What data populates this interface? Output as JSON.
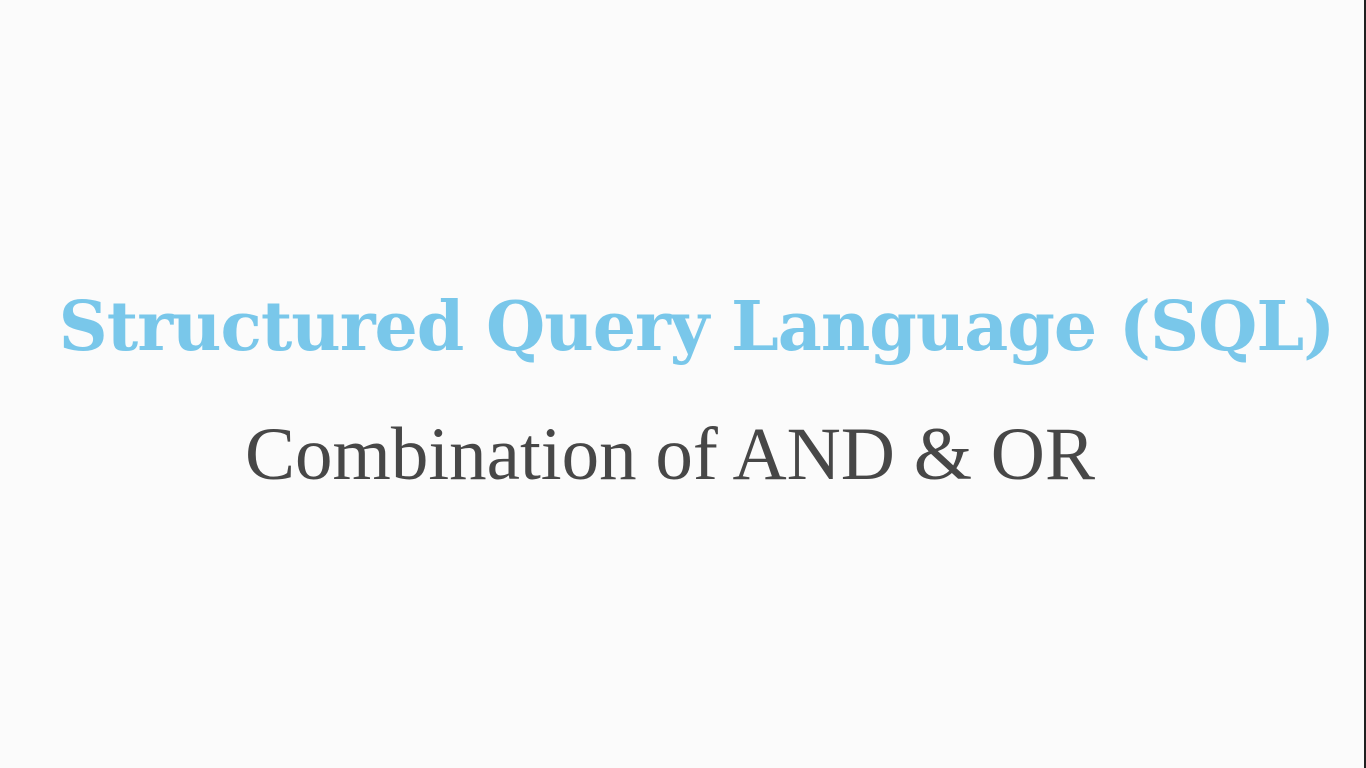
{
  "slide": {
    "title": "Structured Query Language (SQL)",
    "subtitle": "Combination of AND & OR"
  },
  "colors": {
    "background": "#fbfbfb",
    "title": "#79c7ea",
    "subtitle": "#474747"
  }
}
